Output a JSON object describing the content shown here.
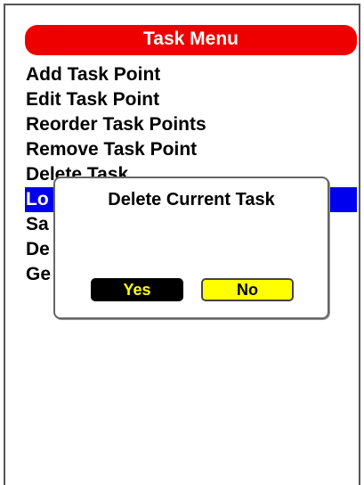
{
  "header": {
    "title": "Task Menu"
  },
  "menu": {
    "items": [
      {
        "label": "Add Task Point"
      },
      {
        "label": "Edit Task Point"
      },
      {
        "label": "Reorder Task Points"
      },
      {
        "label": "Remove Task Point"
      },
      {
        "label": "Delete Task"
      },
      {
        "label": "Lo",
        "selected": true
      },
      {
        "label": "Sa"
      },
      {
        "label": "De"
      },
      {
        "label": "Ge"
      }
    ]
  },
  "dialog": {
    "title": "Delete Current Task",
    "yes_label": "Yes",
    "no_label": "No"
  },
  "colors": {
    "title_bar": "#ee0000",
    "selection": "#0000ee",
    "yes_button_bg": "#000000",
    "yes_button_text": "#ffff00",
    "no_button_bg": "#ffff00",
    "no_button_text": "#000000"
  }
}
